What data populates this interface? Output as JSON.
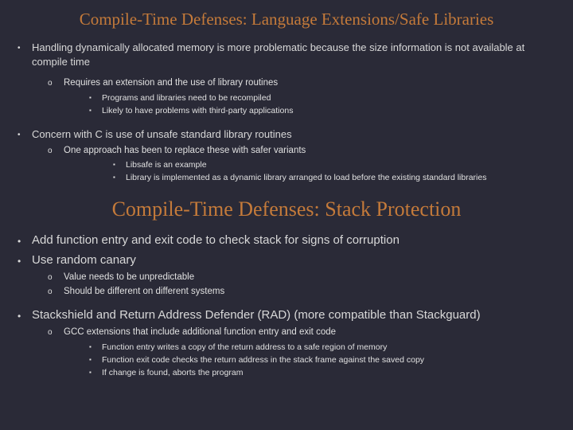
{
  "title1": "Compile-Time Defenses: Language Extensions/Safe Libraries",
  "s1": {
    "p1": "Handling dynamically allocated memory is more problematic because the size information is not available at compile time",
    "p1_o1": "Requires an extension and the use of library routines",
    "p1_o1_b1": "Programs and libraries need to be recompiled",
    "p1_o1_b2": "Likely to have problems with third-party applications",
    "p2": "Concern with C is use of unsafe standard library routines",
    "p2_o1": "One approach has been to replace these with safer variants",
    "p2_o1_b1": "Libsafe is an example",
    "p2_o1_b2": "Library is implemented as a dynamic library arranged to load before the existing standard libraries"
  },
  "title2": "Compile-Time Defenses: Stack Protection",
  "s2": {
    "p1": "Add function entry and exit code to check stack for signs of corruption",
    "p2": "Use random canary",
    "p2_o1": "Value needs to be unpredictable",
    "p2_o2": "Should be different on different systems",
    "p3": "Stackshield and Return Address Defender (RAD) (more compatible than Stackguard)",
    "p3_o1": "GCC extensions that include additional function entry and exit code",
    "p3_o1_b1": "Function entry writes a copy of the return address to a safe region of memory",
    "p3_o1_b2": "Function exit code checks the return address in the stack frame against the saved copy",
    "p3_o1_b3": "If change is found, aborts the program"
  },
  "markers": {
    "bullet": "•",
    "circle": "o",
    "square": "▪"
  }
}
